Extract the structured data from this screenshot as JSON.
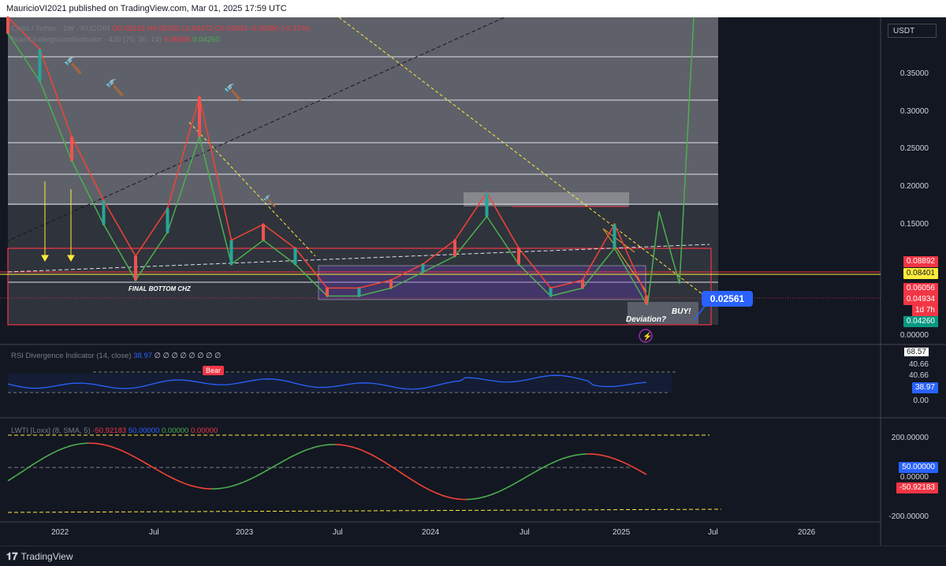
{
  "header": {
    "text": "MauricioVI2021 published on TradingView.com, Mar 01, 2025 17:59 UTC"
  },
  "footer": {
    "brand": "TradingView"
  },
  "main_legend": {
    "symbol": "Chiliz / Tether · 1W · KUCOIN",
    "o": "O0.05216",
    "h": "H0.05230",
    "l": "L0.04472",
    "c": "C0.04934",
    "chg": "-0.00280 (-5.37%)",
    "indicator": "TeamUndergroundIndicator · 420 (70, 30, 14)",
    "ind_v1": "0.06056",
    "ind_v2": "0.04260"
  },
  "currency": "USDT",
  "price_axis": [
    "0.35000",
    "0.30000",
    "0.25000",
    "0.20000",
    "0.15000",
    "0.00000"
  ],
  "price_tags": [
    {
      "label": "0.08892",
      "color": "#f23645",
      "text": "#ffffff"
    },
    {
      "label": "0.08401",
      "color": "#ffeb3b",
      "text": "#131722"
    },
    {
      "label": "0.06056",
      "color": "#f23645",
      "text": "#ffffff"
    },
    {
      "label": "0.04934",
      "color": "#f23645",
      "text": "#ffffff"
    },
    {
      "label": "1d 7h",
      "color": "#f23645",
      "text": "#ffffff"
    },
    {
      "label": "0.04260",
      "color": "#089981",
      "text": "#ffffff"
    }
  ],
  "annotations": {
    "final_bottom": "FINAL BOTTOM CHZ",
    "buy": "BUY!",
    "deviation": "Deviation?",
    "callout": "0.02561"
  },
  "rsi": {
    "legend": "RSI Divergence Indicator (14, close)",
    "value": "38.97",
    "empties": "∅ ∅ ∅ ∅ ∅ ∅ ∅ ∅",
    "bear_label": "Bear",
    "axis": [
      "68.57",
      "40.66",
      "40.66",
      "0.00"
    ],
    "tag": "38.97"
  },
  "lwti": {
    "legend": "LWTI [Loxx] (8, SMA, 5)",
    "v1": "-50.92183",
    "v2": "50.00000",
    "v3": "0.00000",
    "v4": "0.00000",
    "axis": [
      "200.00000",
      "0.00000",
      "-200.00000"
    ],
    "tag_mid": "50.00000",
    "tag_val": "-50.92183"
  },
  "time_axis": [
    "2022",
    "Jul",
    "2023",
    "Jul",
    "2024",
    "Jul",
    "2025",
    "Jul",
    "2026"
  ],
  "colors": {
    "bull": "#26a69a",
    "bear": "#ef5350",
    "green_line": "#4caf50",
    "red_line": "#f44336",
    "rsi_line": "#2962ff",
    "bg": "#131722"
  },
  "chart_data": {
    "type": "line",
    "title": "",
    "xlabel": "",
    "ylabel": "",
    "x": [
      "2021-10",
      "2021-12",
      "2022-02",
      "2022-04",
      "2022-06",
      "2022-08",
      "2022-10",
      "2022-12",
      "2023-02",
      "2023-04",
      "2023-06",
      "2023-08",
      "2023-10",
      "2023-12",
      "2024-02",
      "2024-04",
      "2024-06",
      "2024-08",
      "2024-10",
      "2024-12",
      "2025-02"
    ],
    "ylim": [
      0,
      0.4
    ],
    "series": [
      {
        "name": "",
        "values": [
          0.4,
          0.36,
          0.25,
          0.17,
          0.1,
          0.16,
          0.3,
          0.12,
          0.14,
          0.11,
          0.06,
          0.06,
          0.07,
          0.09,
          0.12,
          0.18,
          0.11,
          0.06,
          0.07,
          0.14,
          0.05
        ]
      },
      {
        "name": "",
        "values": [
          0.38,
          0.32,
          0.22,
          0.14,
          0.07,
          0.13,
          0.25,
          0.09,
          0.12,
          0.09,
          0.05,
          0.05,
          0.06,
          0.08,
          0.1,
          0.15,
          0.09,
          0.05,
          0.06,
          0.11,
          0.04
        ]
      }
    ]
  }
}
